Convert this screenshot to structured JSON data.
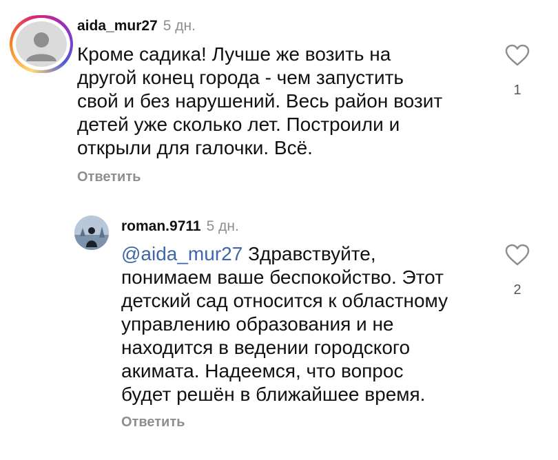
{
  "comments": [
    {
      "username": "aida_mur27",
      "time": "5 дн.",
      "text": "Кроме садика! Лучше же возить на\nдругой конец города - чем запустить\nсвой и без нарушений. Весь район возит\nдетей уже сколько лет. Построили и\nоткрыли для галочки. Всё.",
      "reply_label": "Ответить",
      "likes": "1"
    },
    {
      "username": "roman.9711",
      "time": "5 дн.",
      "mention": "@aida_mur27",
      "text": " Здравствуйте,\nпонимаем ваше беспокойство. Этот\nдетский сад относится к областному\nуправлению образования и не\nнаходится в ведении городского\nакимата. Надеемся, что вопрос\nбудет решён в ближайшее время.",
      "reply_label": "Ответить",
      "likes": "2"
    }
  ],
  "colors": {
    "mention": "#3f66a8",
    "secondary_text": "#8e8e8e"
  }
}
